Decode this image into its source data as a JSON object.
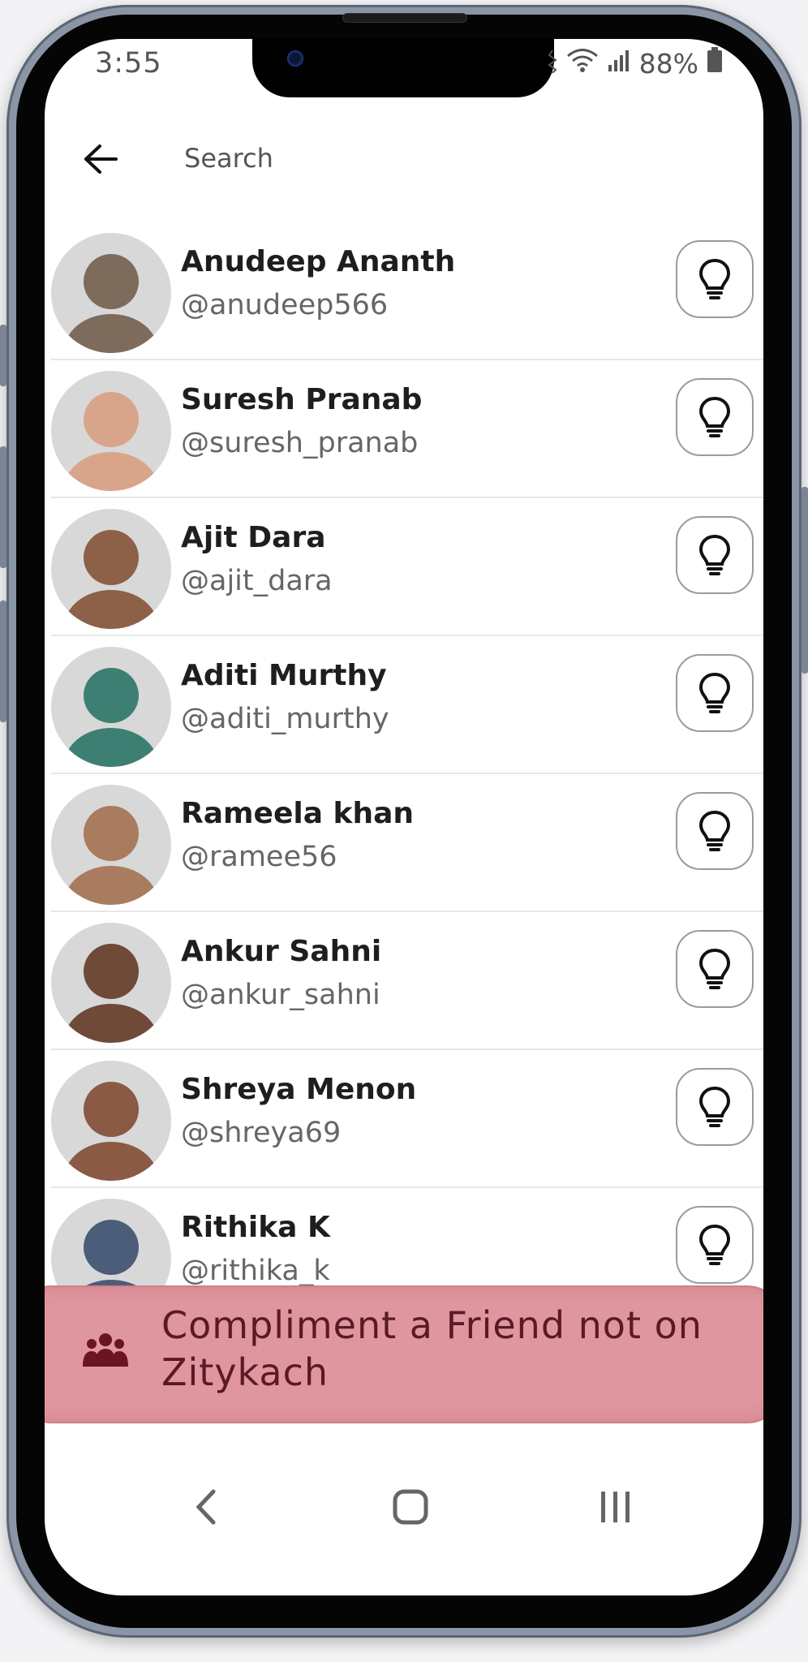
{
  "status_bar": {
    "time": "3:55",
    "battery": "88%"
  },
  "search": {
    "placeholder": "Search",
    "value": ""
  },
  "contacts": [
    {
      "name": "Anudeep Ananth",
      "handle": "@anudeep566",
      "avatar_color": "#7d6b5c"
    },
    {
      "name": "Suresh Pranab",
      "handle": "@suresh_pranab",
      "avatar_color": "#d9a58a"
    },
    {
      "name": "Ajit Dara",
      "handle": "@ajit_dara",
      "avatar_color": "#8d6048"
    },
    {
      "name": "Aditi Murthy",
      "handle": "@aditi_murthy",
      "avatar_color": "#3e7f73"
    },
    {
      "name": "Rameela khan",
      "handle": "@ramee56",
      "avatar_color": "#a97b5f"
    },
    {
      "name": "Ankur Sahni",
      "handle": "@ankur_sahni",
      "avatar_color": "#6f4a38"
    },
    {
      "name": "Shreya Menon",
      "handle": "@shreya69",
      "avatar_color": "#8b5a44"
    },
    {
      "name": "Rithika K",
      "handle": "@rithika_k",
      "avatar_color": "#4b5d78"
    }
  ],
  "banner": {
    "label": "Compliment a Friend not on Zitykach",
    "color": "#e0969e"
  },
  "colors": {
    "accent": "#5a1a25",
    "text_primary": "#1e1e1e",
    "text_secondary": "#666666"
  }
}
